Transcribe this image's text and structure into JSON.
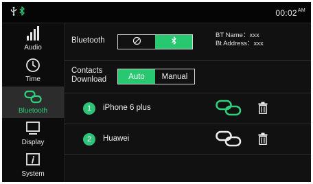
{
  "status_bar": {
    "time": "00:02",
    "ampm": "AM",
    "usb_icon": "usb-icon",
    "bluetooth_icon": "bluetooth-icon"
  },
  "sidebar": {
    "items": [
      {
        "label": "Audio",
        "icon": "equalizer-icon"
      },
      {
        "label": "Time",
        "icon": "clock-icon"
      },
      {
        "label": "Bluetooth",
        "icon": "link-icon",
        "active": true
      },
      {
        "label": "Display",
        "icon": "monitor-icon"
      },
      {
        "label": "System",
        "icon": "info-icon"
      }
    ]
  },
  "bluetooth": {
    "label": "Bluetooth",
    "toggle_off_icon": "off-icon",
    "toggle_on_icon": "bluetooth-icon",
    "selected": "on",
    "bt_name": "BT Name：xxx",
    "bt_address": "Bt Address：xxx"
  },
  "contacts": {
    "label_line1": "Contacts",
    "label_line2": "Download",
    "options": [
      "Auto",
      "Manual"
    ],
    "selected": "Auto"
  },
  "devices": [
    {
      "index": "1",
      "name": "iPhone 6 plus",
      "connected": true
    },
    {
      "index": "2",
      "name": "Huawei",
      "connected": false
    }
  ],
  "colors": {
    "accent": "#28c870",
    "background": "#0a0a0a",
    "text": "#ededed"
  }
}
